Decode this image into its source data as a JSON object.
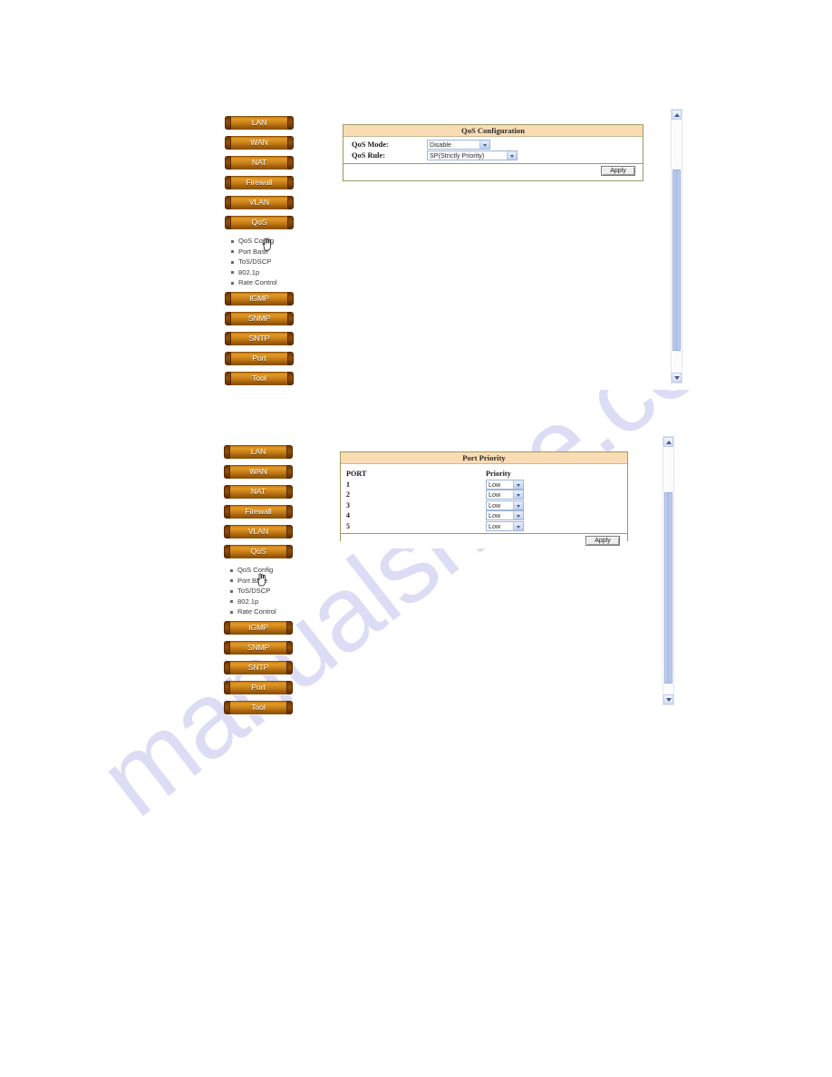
{
  "watermark": {
    "text": "manualshine.com"
  },
  "sidebar": {
    "buttons": [
      {
        "label": "LAN"
      },
      {
        "label": "WAN"
      },
      {
        "label": "NAT"
      },
      {
        "label": "Firewall"
      },
      {
        "label": "VLAN"
      },
      {
        "label": "QoS"
      }
    ],
    "submenu": [
      {
        "label": "QoS Config"
      },
      {
        "label": "Port Base"
      },
      {
        "label": "ToS/DSCP"
      },
      {
        "label": "802.1p"
      },
      {
        "label": "Rate Control"
      }
    ],
    "buttons_after": [
      {
        "label": "IGMP"
      },
      {
        "label": "SNMP"
      },
      {
        "label": "SNTP"
      },
      {
        "label": "Port"
      },
      {
        "label": "Tool"
      }
    ]
  },
  "panel_qos": {
    "title": "QoS Configuration",
    "rows": [
      {
        "label": "QoS Mode:",
        "value": "Disable"
      },
      {
        "label": "QoS Rule:",
        "value": "SP(Strictly Priority)"
      }
    ],
    "apply_label": "Apply"
  },
  "panel_port_priority": {
    "title": "Port Priority",
    "col_port": "PORT",
    "col_priority": "Priority",
    "rows": [
      {
        "port": "1",
        "priority": "Low"
      },
      {
        "port": "2",
        "priority": "Low"
      },
      {
        "port": "3",
        "priority": "Low"
      },
      {
        "port": "4",
        "priority": "Low"
      },
      {
        "port": "5",
        "priority": "Low"
      }
    ],
    "apply_label": "Apply"
  },
  "colors": {
    "nav_button": "#c87f18",
    "panel_header": "#fadcb4",
    "panel_border": "#9a9a62",
    "select_border": "#9fb4d8",
    "scrollbar_thumb": "#aabce6",
    "watermark": "#c8c8f0"
  }
}
